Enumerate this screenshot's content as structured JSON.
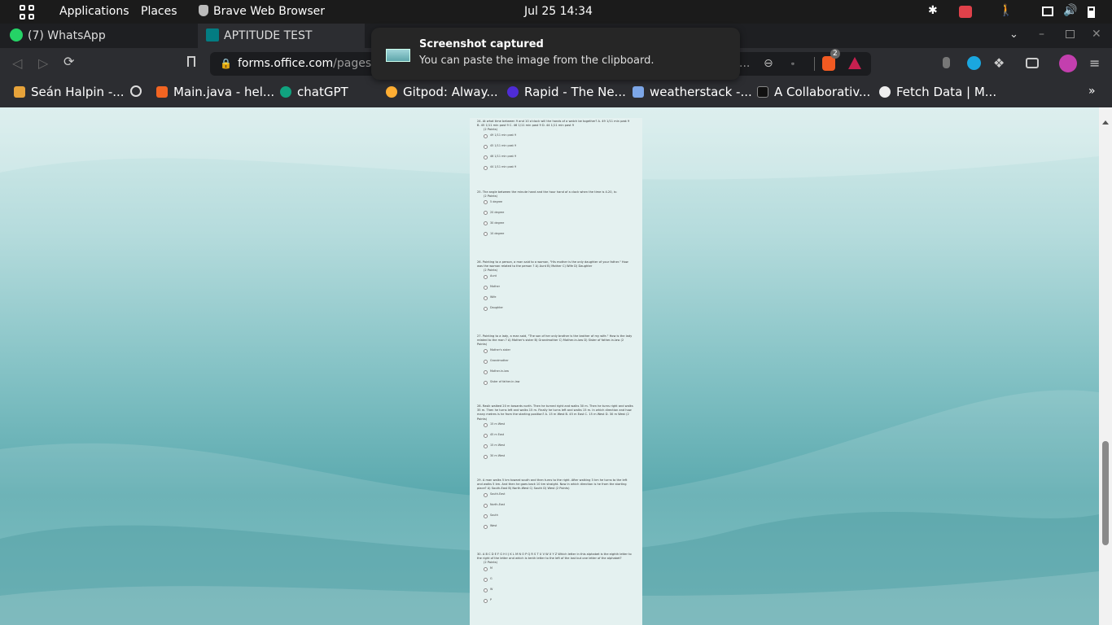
{
  "topbar": {
    "menu": [
      "Applications",
      "Places"
    ],
    "active_app": "Brave Web Browser",
    "clock": "Jul 25  14:34"
  },
  "tabs": [
    {
      "label": "(7) WhatsApp",
      "badge": "7",
      "active": false
    },
    {
      "label": "APTITUDE TEST",
      "active": true
    }
  ],
  "toolbar": {
    "url_host": "forms.office.com",
    "url_path": "/pages/re",
    "url_tail": "...",
    "shield_count": "2"
  },
  "bookmarks": [
    "Seán Halpin -...",
    "Main.java - hel...",
    "chatGPT",
    "Gitpod: Alway...",
    "Rapid - The Ne...",
    "weatherstack -...",
    "A Collaborativ...",
    "Fetch Data | M..."
  ],
  "notification": {
    "title": "Screenshot captured",
    "body": "You can paste the image from the clipboard."
  },
  "form": {
    "questions": [
      {
        "text": "24. At what time between 9 and 10 o'clock will the hands of a watch be together? A. 49 1/11 min past 9 B. 45 1/11 min past 9 C. 46 1/11 min past 9 D. 44 1/11 min past 9",
        "points": "(2 Points)",
        "options": [
          "49 1/11 min past 9",
          "45 1/11 min past 9",
          "46 1/11 min past 9",
          "44 1/11 min past 9"
        ]
      },
      {
        "text": "25. The angle between the minute hand and the hour hand of a clock when the time is 4.20, is:",
        "points": "(2 Points)",
        "options": [
          "5 degree",
          "20 degree",
          "30 degree",
          "10 degree"
        ]
      },
      {
        "text": "26. Pointing to a person, a man said to a woman, \"His mother is the only daughter of your father.\" How was the woman related to the person ? A) Aunt B) Mother C) Wife D) Daughter",
        "points": "(2 Points)",
        "options": [
          "Aunt",
          "Mother",
          "Wife",
          "Daughter"
        ]
      },
      {
        "text": "27. Pointing to a lady, a man said, \"The son of her only brother is the brother of my wife.\" How is the lady related to the man ? A) Mother's sister B) Grandmother C) Mother-in-law D) Sister of father-in-law (2 Points)",
        "points": "",
        "options": [
          "Mother's sister",
          "Grandmother",
          "Mother-in-law",
          "Sister of father-in-law"
        ]
      },
      {
        "text": "28. Rasik walked 20 m towards north. Then he turned right and walks 30 m. Then he turns right and walks 35 m. Then he turns left and walks 15 m. Finally he turns left and walks 15 m. In which direction and how many metres is he from the starting position? A. 15 m West B. 45 m East C. 15 m West D. 30 m West (2 Points)",
        "points": "",
        "options": [
          "15 m West",
          "45 m East",
          "15 m West",
          "30 m West"
        ]
      },
      {
        "text": "29. A man walks 5 km toward south and then turns to the right. After walking 3 km he turns to the left and walks 5 km. And then he goes back 10 km straight. Now in which direction is he from the starting place? A) South-East B) North-West C) South D) West (2 Points)",
        "points": "",
        "options": [
          "South-East",
          "North-East",
          "South",
          "West"
        ]
      },
      {
        "text": "30. A B C D E F G H I J K L M N O P Q R S T U V W X Y Z Which letter in this alphabet is the eighth letter to the right of the letter and which is tenth letter to the left of the last but one letter of the alphabet?",
        "points": "(2 Points)",
        "options": [
          "M",
          "G",
          "W",
          "P"
        ]
      }
    ]
  }
}
